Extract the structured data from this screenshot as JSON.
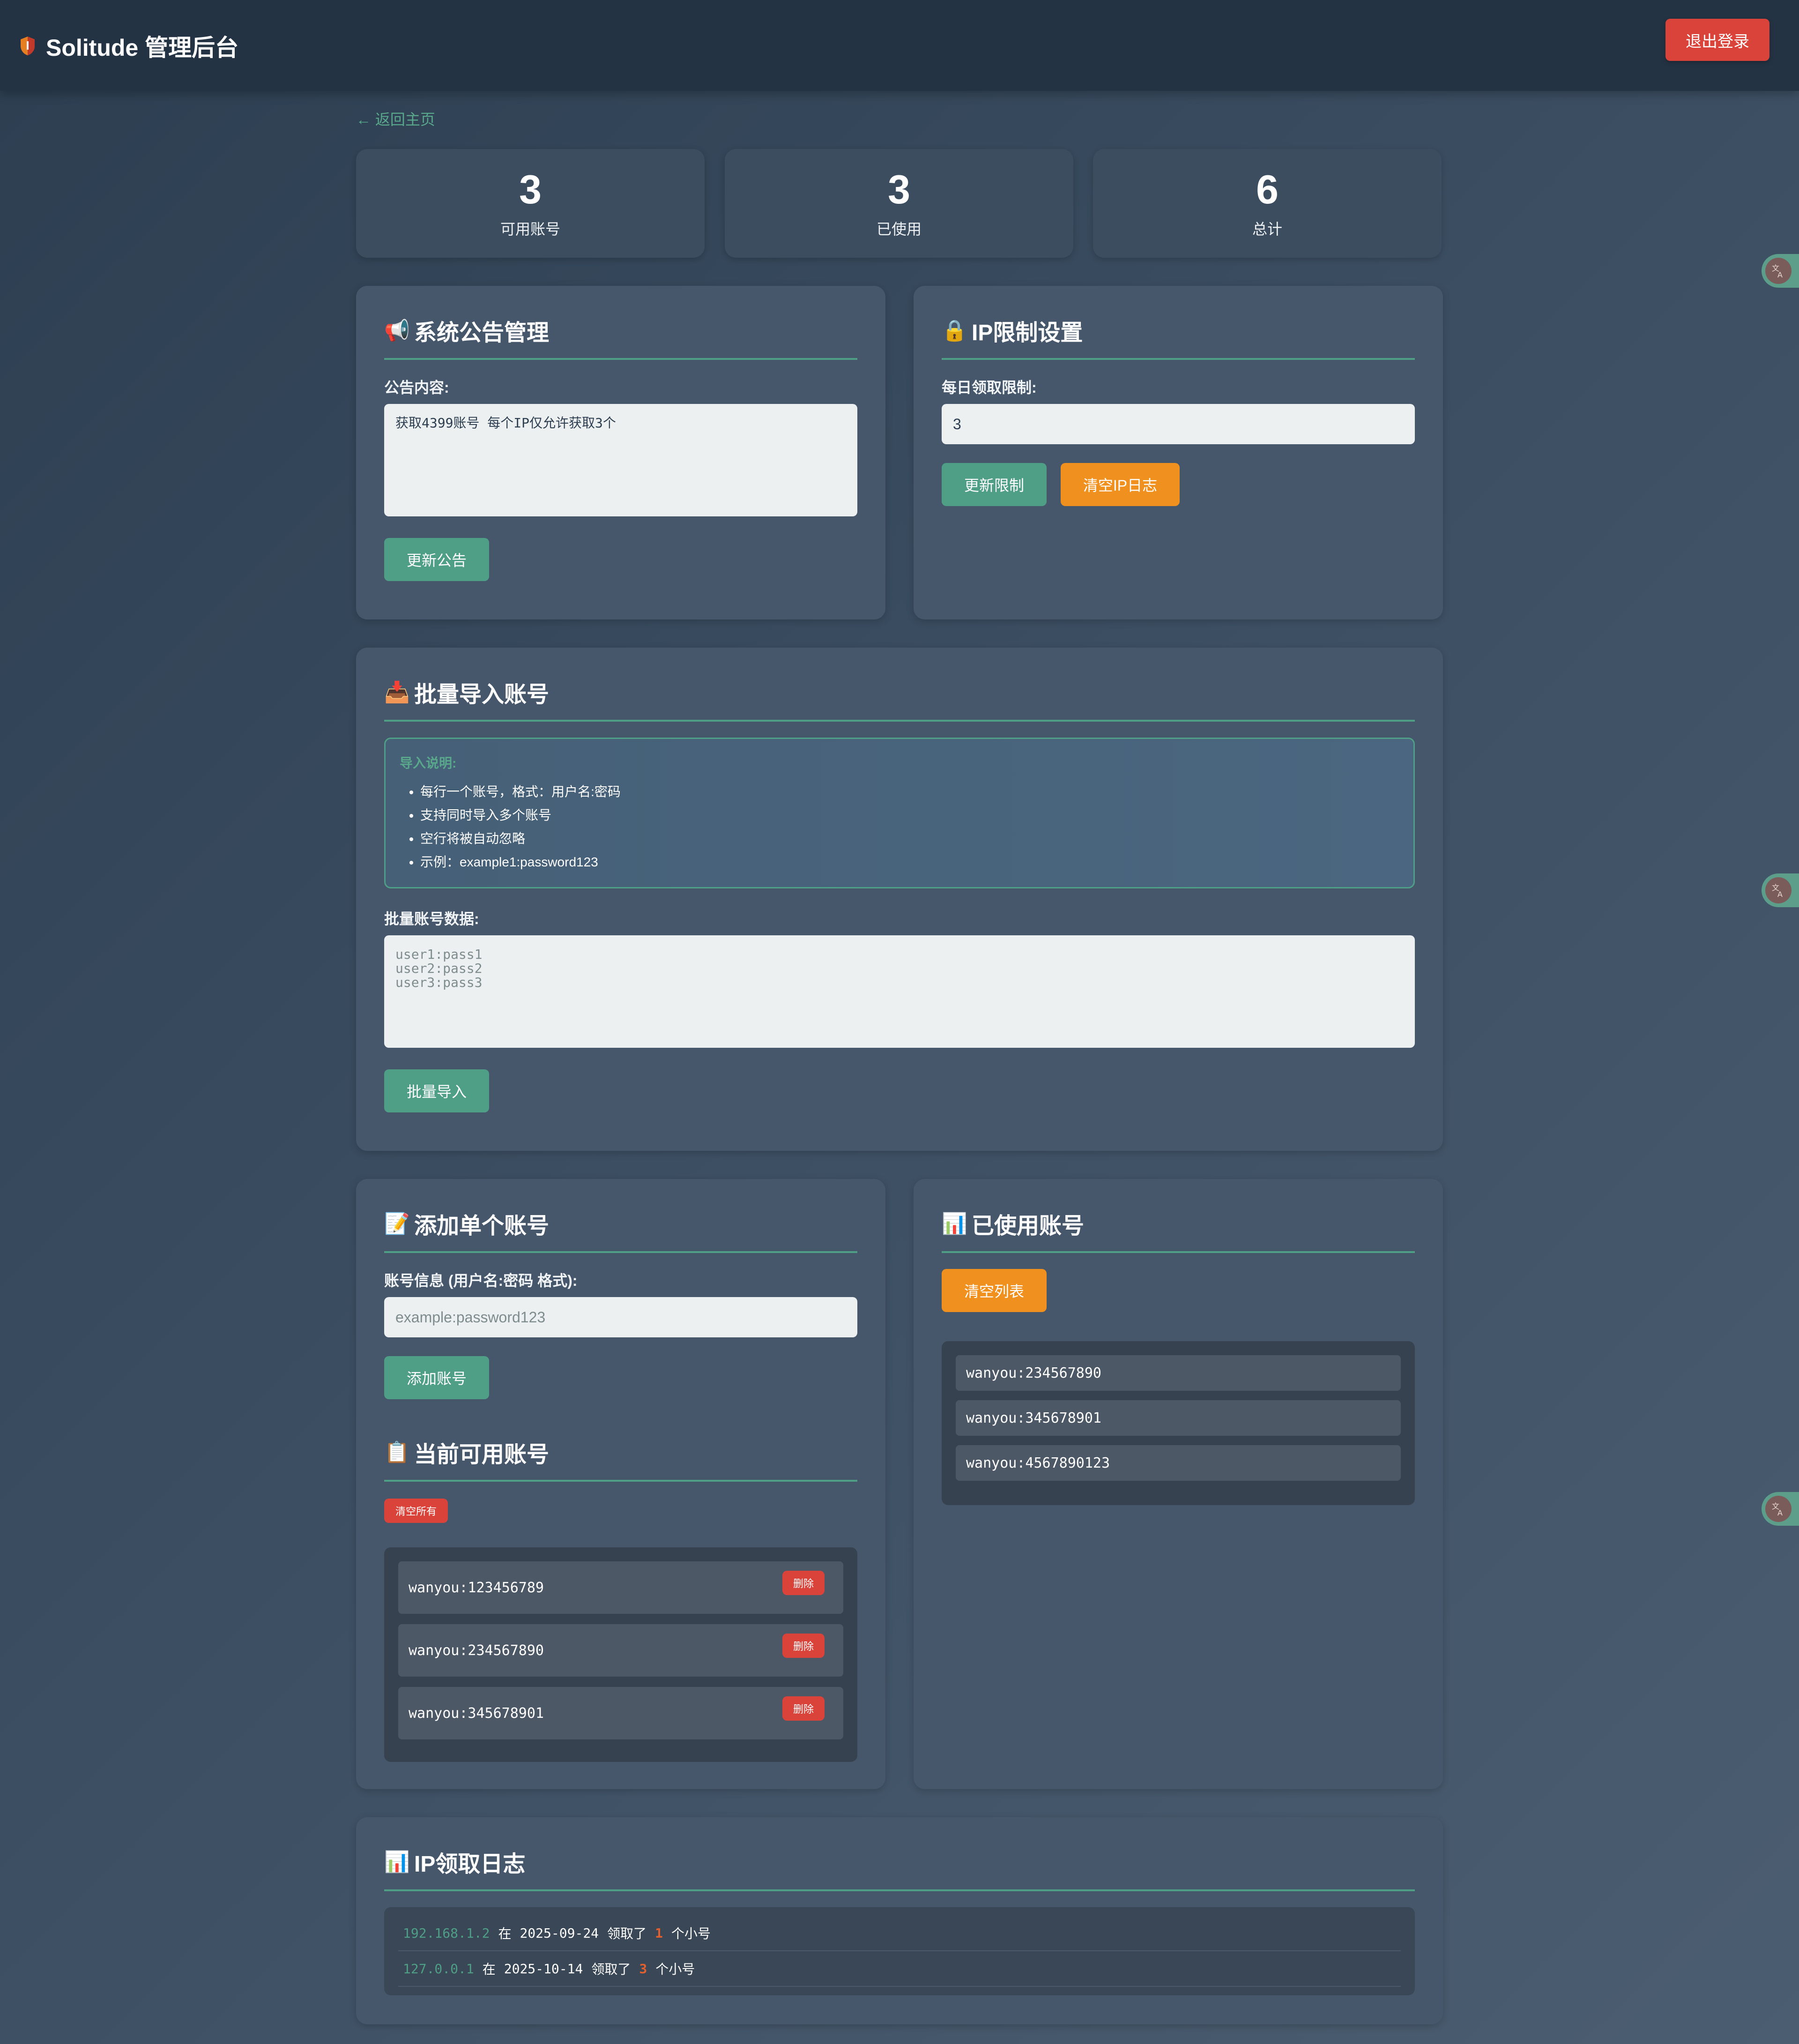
{
  "header": {
    "title": "Solitude 管理后台",
    "logout_label": "退出登录"
  },
  "nav": {
    "back_label": "← 返回主页"
  },
  "stats": [
    {
      "value": "3",
      "label": "可用账号"
    },
    {
      "value": "3",
      "label": "已使用"
    },
    {
      "value": "6",
      "label": "总计"
    }
  ],
  "announcement": {
    "title": "系统公告管理",
    "content_label": "公告内容:",
    "content_value": "获取4399账号 每个IP仅允许获取3个",
    "update_label": "更新公告"
  },
  "ip_limit": {
    "title": "IP限制设置",
    "limit_label": "每日领取限制:",
    "limit_value": "3",
    "update_label": "更新限制",
    "clear_label": "清空IP日志"
  },
  "bulk_import": {
    "title": "批量导入账号",
    "info_title": "导入说明:",
    "info_items": [
      "每行一个账号，格式：用户名:密码",
      "支持同时导入多个账号",
      "空行将被自动忽略",
      "示例：example1:password123"
    ],
    "data_label": "批量账号数据:",
    "data_placeholder": "user1:pass1\nuser2:pass2\nuser3:pass3",
    "import_label": "批量导入"
  },
  "add_single": {
    "title": "添加单个账号",
    "field_label": "账号信息 (用户名:密码 格式):",
    "placeholder": "example:password123",
    "add_label": "添加账号"
  },
  "available": {
    "title": "当前可用账号",
    "clear_all_label": "清空所有",
    "delete_label": "删除",
    "accounts": [
      "wanyou:123456789",
      "wanyou:234567890",
      "wanyou:345678901"
    ]
  },
  "used": {
    "title": "已使用账号",
    "clear_label": "清空列表",
    "accounts": [
      "wanyou:234567890",
      "wanyou:345678901",
      "wanyou:4567890123"
    ]
  },
  "ip_log": {
    "title": "IP领取日志",
    "word_at": "在",
    "word_got": "领取了",
    "word_unit": "个小号",
    "entries": [
      {
        "ip": "192.168.1.2",
        "date": "2025-09-24",
        "count": "1"
      },
      {
        "ip": "127.0.0.1",
        "date": "2025-10-14",
        "count": "3"
      }
    ]
  },
  "colors": {
    "accent": "#4f9e86",
    "danger": "#d9433a",
    "warning": "#f0901e",
    "header_bg": "#243344"
  }
}
